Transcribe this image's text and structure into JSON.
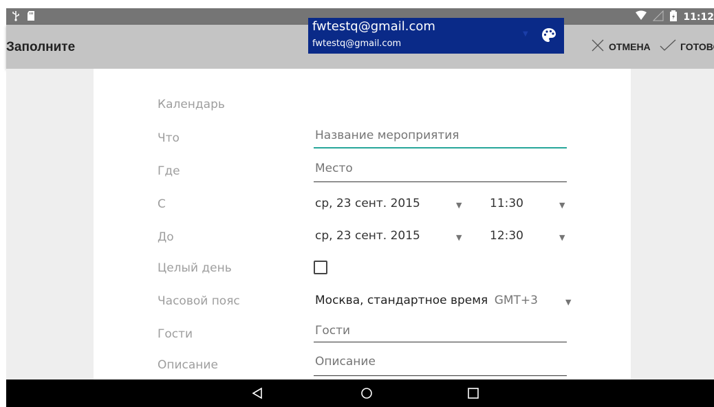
{
  "status": {
    "time": "11:12"
  },
  "actionbar": {
    "title": "Заполните",
    "cancel_label": "ОТМЕНА",
    "done_label": "ГОТОВО"
  },
  "form": {
    "calendar": {
      "label": "Календарь",
      "account": "fwtestq@gmail.com",
      "sub": "fwtestq@gmail.com"
    },
    "what": {
      "label": "Что",
      "placeholder": "Название мероприятия"
    },
    "where": {
      "label": "Где",
      "placeholder": "Место"
    },
    "from": {
      "label": "С",
      "date": "ср, 23 сент. 2015",
      "time": "11:30"
    },
    "to": {
      "label": "До",
      "date": "ср, 23 сент. 2015",
      "time": "12:30"
    },
    "allday": {
      "label": "Целый день",
      "checked": false
    },
    "timezone": {
      "label": "Часовой пояс",
      "value": "Москва, стандартное время",
      "offset": "GMT+3"
    },
    "guests": {
      "label": "Гости",
      "placeholder": "Гости"
    },
    "description": {
      "label": "Описание",
      "placeholder": "Описание"
    }
  },
  "colors": {
    "statusbar": "#757575",
    "actionbar": "#c4c4c4",
    "calendar": "#0a2a88",
    "accent_underline": "#26a69a"
  },
  "icons": {
    "usb": "usb-icon",
    "sdcard": "sd-card-icon",
    "wifi": "wifi-icon",
    "signal": "signal-icon",
    "battery": "battery-icon",
    "cancel": "close-icon",
    "done": "check-icon",
    "palette": "palette-icon",
    "back": "back-icon",
    "home": "home-icon",
    "recents": "recents-icon"
  }
}
